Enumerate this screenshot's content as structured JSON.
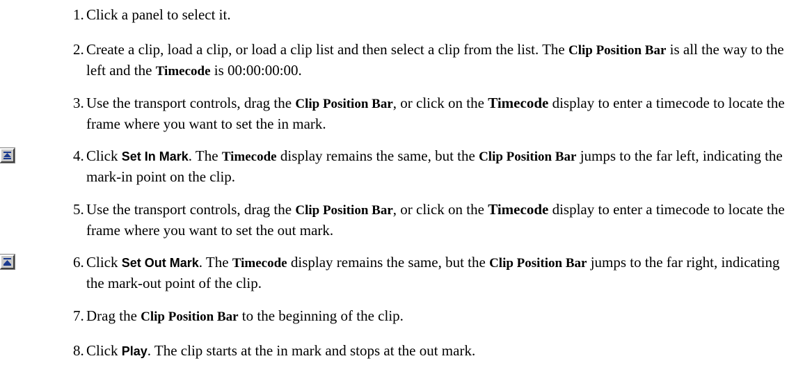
{
  "steps": [
    {
      "number": "1.",
      "segments": [
        {
          "t": "Click a panel to select it."
        }
      ]
    },
    {
      "number": "2.",
      "segments": [
        {
          "t": "Create a clip, load a clip, or load a clip list and then select a clip from the list. The "
        },
        {
          "t": "Clip Position Bar",
          "s": "serif"
        },
        {
          "t": " is all the way to the left and the "
        },
        {
          "t": "Timecode",
          "s": "serif"
        },
        {
          "t": " is 00:00:00:00."
        }
      ]
    },
    {
      "number": "3.",
      "segments": [
        {
          "t": "Use the transport controls, drag the "
        },
        {
          "t": "Clip Position Bar",
          "s": "serif"
        },
        {
          "t": ", or click on the "
        },
        {
          "t": "Timecode",
          "s": "serif-lg"
        },
        {
          "t": " display to enter a timecode to locate the frame where you want to set the in mark."
        }
      ]
    },
    {
      "number": "4.",
      "icon": "set-in-mark-icon",
      "segments": [
        {
          "t": "Click "
        },
        {
          "t": "Set In Mark",
          "s": "sans"
        },
        {
          "t": ". The "
        },
        {
          "t": "Timecode",
          "s": "serif"
        },
        {
          "t": " display remains the same, but the "
        },
        {
          "t": "Clip Position Bar",
          "s": "serif"
        },
        {
          "t": " jumps to the far left, indicating the mark-in point on the clip."
        }
      ]
    },
    {
      "number": "5.",
      "segments": [
        {
          "t": "Use the transport controls, drag the "
        },
        {
          "t": "Clip Position Bar",
          "s": "serif"
        },
        {
          "t": ", or click on the "
        },
        {
          "t": "Timecode",
          "s": "serif-lg"
        },
        {
          "t": " display to enter a timecode to locate the frame where you want to set the out mark."
        }
      ]
    },
    {
      "number": "6.",
      "icon": "set-out-mark-icon",
      "segments": [
        {
          "t": "Click "
        },
        {
          "t": "Set Out Mark",
          "s": "sans"
        },
        {
          "t": ". The "
        },
        {
          "t": "Timecode",
          "s": "serif"
        },
        {
          "t": " display remains the same, but the "
        },
        {
          "t": "Clip Position Bar",
          "s": "serif"
        },
        {
          "t": " jumps to the far right, indicating the mark-out point of the clip."
        }
      ]
    },
    {
      "number": "7.",
      "segments": [
        {
          "t": "Drag the "
        },
        {
          "t": "Clip Position Bar",
          "s": "serif"
        },
        {
          "t": " to the beginning of the clip."
        }
      ]
    },
    {
      "number": "8.",
      "segments": [
        {
          "t": "Click "
        },
        {
          "t": "Play",
          "s": "sans"
        },
        {
          "t": ". The clip starts at the in mark and stops at the out mark."
        }
      ]
    }
  ],
  "colors": {
    "icon_fill": "#c8c8c8",
    "icon_glyph": "#1a3a8f",
    "text": "#000000"
  }
}
